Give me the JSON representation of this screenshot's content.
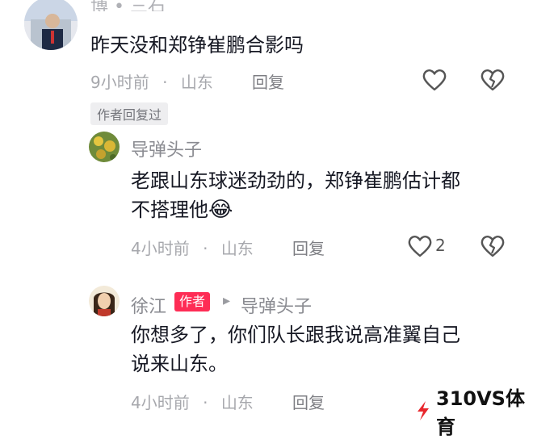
{
  "top_cutoff": "",
  "comments": [
    {
      "name": "博 • 三石",
      "text": "昨天没和郑铮崔鹏合影吗",
      "time": "9小时前",
      "dot": "·",
      "location": "山东",
      "reply_label": "回复",
      "like_count": ""
    },
    {
      "name": "导弹头子",
      "text_line1": "老跟山东球迷劲劲的，郑铮崔鹏估计都",
      "text_line2": "不搭理他",
      "emoji": "😂",
      "time": "4小时前",
      "dot": "·",
      "location": "山东",
      "reply_label": "回复",
      "like_count": "2"
    },
    {
      "name": "徐江",
      "author_badge": "作者",
      "reply_to_arrow": "▸",
      "reply_to": "导弹头子",
      "text_line1": "你想多了，你们队长跟我说高准翼自己",
      "text_line2": "说来山东。",
      "time": "4小时前",
      "dot": "·",
      "location": "山东",
      "reply_label": "回复"
    }
  ],
  "author_replied_tag": "作者回复过",
  "watermark": {
    "text": "310VS体育",
    "accent": "#e8262c"
  },
  "colors": {
    "author_badge": "#fe2c55",
    "name_gray": "#8a8b91",
    "text": "#161823"
  }
}
